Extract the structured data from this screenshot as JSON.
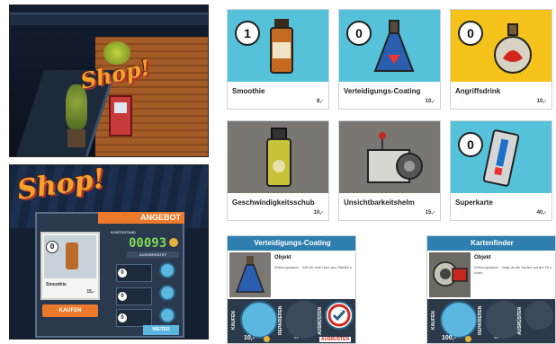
{
  "scene": {
    "sign_text": "Shop!"
  },
  "shop_menu": {
    "logo": "Shop!",
    "banner": "ANGEBOT",
    "card_count": "0",
    "card_name": "Smoothie",
    "card_price": "15,-",
    "buy_label": "KAUFEN",
    "counter_label": "KONTOSTAND",
    "counter_value": "00093",
    "equip_label": "AUSGERÜSTET",
    "slot_numbers": [
      "0",
      "0",
      "0"
    ],
    "continue_label": "WEITER"
  },
  "items": [
    {
      "name": "Smoothie",
      "price": "8,-",
      "count": "1",
      "bg": "#55c2da",
      "icon": "smoothie-bottle-icon"
    },
    {
      "name": "Verteidigungs-Coating",
      "price": "10,-",
      "count": "0",
      "bg": "#55c2da",
      "icon": "coating-flask-icon"
    },
    {
      "name": "Angriffsdrink",
      "price": "10,-",
      "count": "0",
      "bg": "#f4c21a",
      "icon": "attack-drink-icon"
    },
    {
      "name": "Geschwindigkeitsschub",
      "price": "10,-",
      "count": "",
      "bg": "#7a7672",
      "icon": "speed-boost-icon"
    },
    {
      "name": "Unsichtbarkeitshelm",
      "price": "15,-",
      "count": "",
      "bg": "#7a7672",
      "icon": "invisibility-helmet-icon"
    },
    {
      "name": "Superkarte",
      "price": "40,-",
      "count": "0",
      "bg": "#55c2da",
      "icon": "super-card-icon"
    }
  ],
  "details": [
    {
      "title": "Verteidigungs-Coating",
      "type": "Objekt",
      "text": "Wirkungsdauer · Gibt dir eine Haut aus Stahl.",
      "value": "15 s",
      "buy_label": "KAUFEN",
      "repair_label": "REPARIEREN",
      "equip_label": "AUSRÜSTEN",
      "buy_price": "10,-",
      "repair_price": "--",
      "equipped_caption": "AUSRÜSTEN"
    },
    {
      "title": "Kartenfinder",
      "type": "Objekt",
      "text": "Wirkungsdauer · Zeigt dir die Karten auf der Karte.",
      "value": "15 s",
      "buy_label": "KAUFEN",
      "repair_label": "REPARIEREN",
      "equip_label": "AUSRÜSTEN",
      "buy_price": "100,-",
      "repair_price": "--"
    }
  ],
  "colors": {
    "accent_orange": "#ec7a2a",
    "item_blue": "#55c2da",
    "item_yellow": "#f4c21a",
    "item_gray": "#7a7672",
    "header_blue": "#2e7fb0"
  }
}
